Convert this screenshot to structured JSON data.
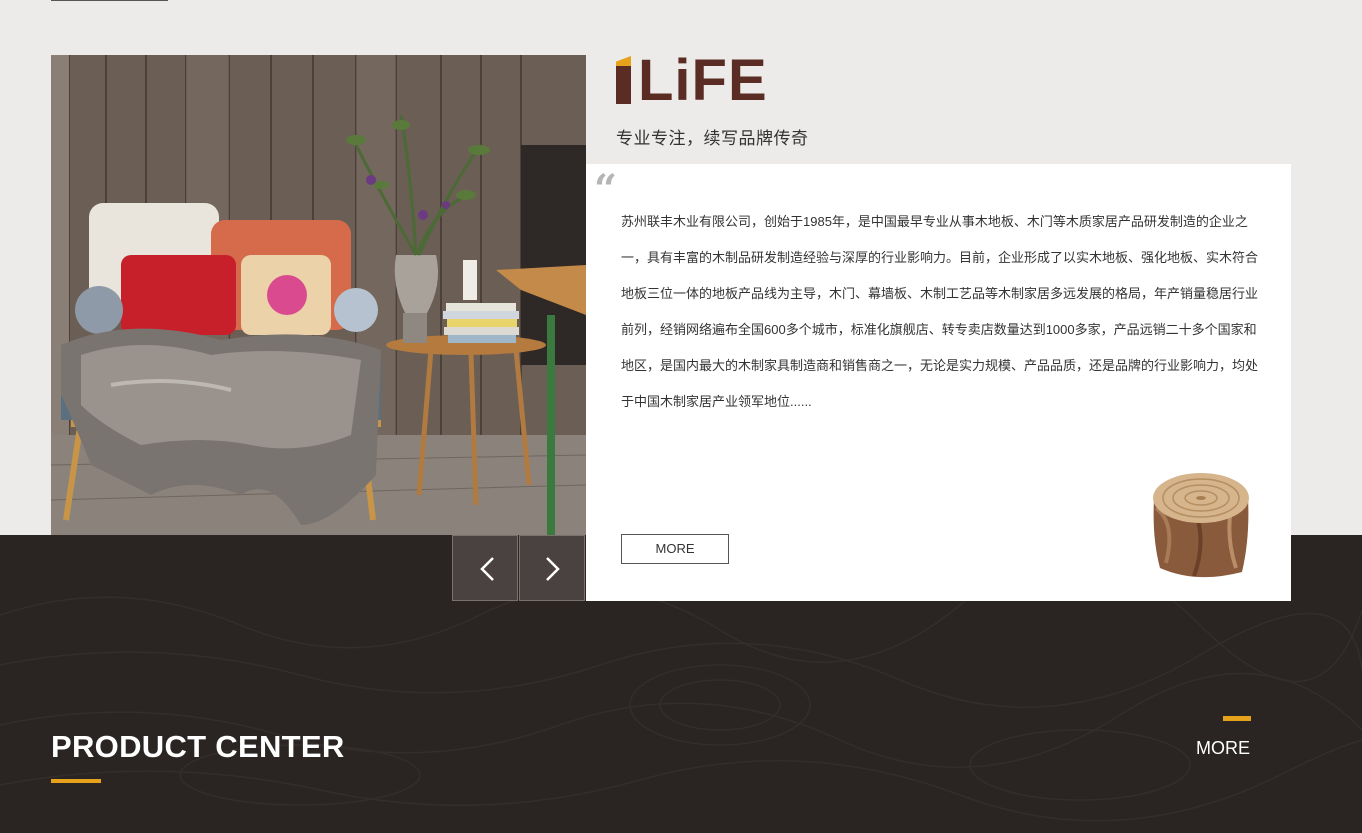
{
  "brand": {
    "logo_text": "LiFE",
    "logo_full": "i LiFE",
    "slogan": "专业专注，续写品牌传奇"
  },
  "hero": {
    "image_alt": "wooden armchair with embroidered cushions and fur throw beside a side table with plants and books"
  },
  "about": {
    "quote_glyph": "“",
    "text": "苏州联丰木业有限公司，创始于1985年，是中国最早专业从事木地板、木门等木质家居产品研发制造的企业之一，具有丰富的木制品研发制造经验与深厚的行业影响力。目前，企业形成了以实木地板、强化地板、实木符合地板三位一体的地板产品线为主导，木门、幕墙板、木制工艺品等木制家居多远发展的格局，年产销量稳居行业前列，经销网络遍布全国600多个城市，标准化旗舰店、转专卖店数量达到1000多家，产品远销二十多个国家和地区，是国内最大的木制家具制造商和销售商之一，无论是实力规模、产品品质，还是品牌的行业影响力，均处于中国木制家居产业领军地位......",
    "more_label": "MORE"
  },
  "slider": {
    "prev_icon": "chevron-left-icon",
    "next_icon": "chevron-right-icon"
  },
  "product_center": {
    "title": "PRODUCT CENTER",
    "more_label": "MORE"
  },
  "colors": {
    "accent": "#e5a21a",
    "brand_brown": "#5a2c24",
    "dark_band": "#2a2523",
    "page_bg": "#ecebe9"
  }
}
